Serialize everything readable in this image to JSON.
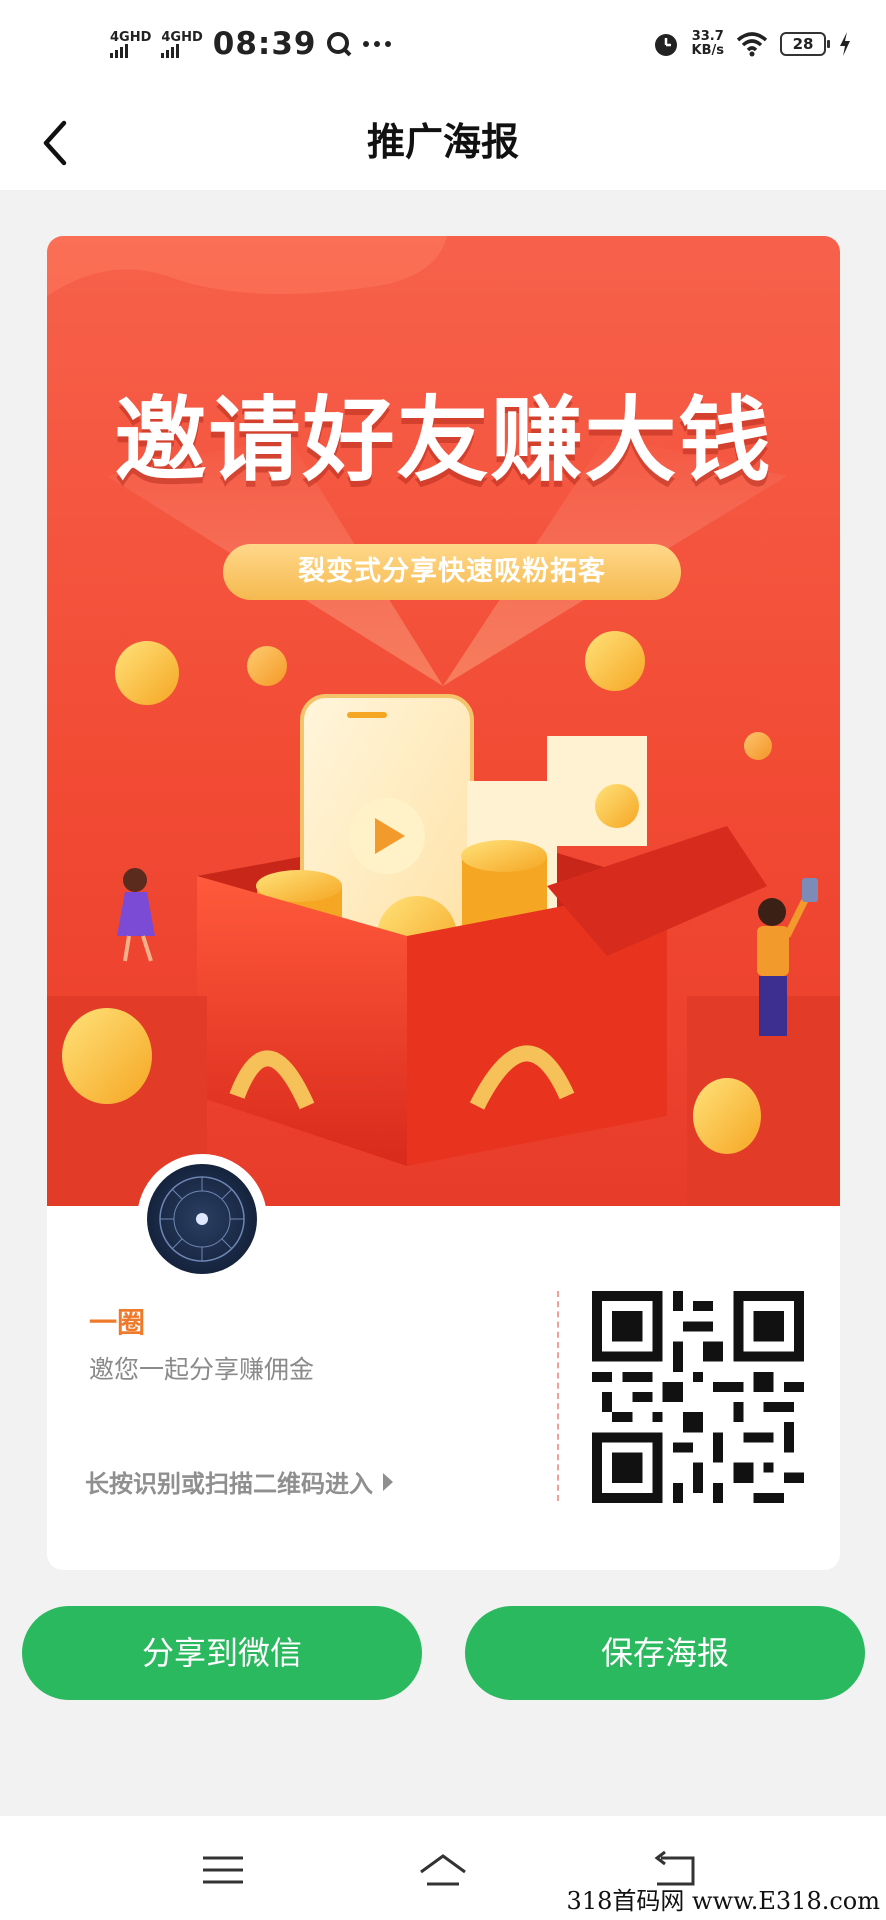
{
  "status_bar": {
    "network1": "4GHD",
    "network2": "4GHD",
    "time": "08:39",
    "speed_value": "33.7",
    "speed_unit": "KB/s",
    "battery": "28"
  },
  "header": {
    "title": "推广海报"
  },
  "poster": {
    "headline": "邀请好友赚大钱",
    "subtitle": "裂变式分享快速吸粉拓客",
    "user_name": "一圈",
    "invite_text": "邀您一起分享赚佣金",
    "scan_hint": "长按识别或扫描二维码进入"
  },
  "actions": {
    "share_label": "分享到微信",
    "save_label": "保存海报"
  },
  "watermark": "318首码网 www.E318.com",
  "colors": {
    "accent_green": "#2bb95f",
    "poster_red": "#f24b34",
    "name_orange": "#ef7a2c"
  }
}
